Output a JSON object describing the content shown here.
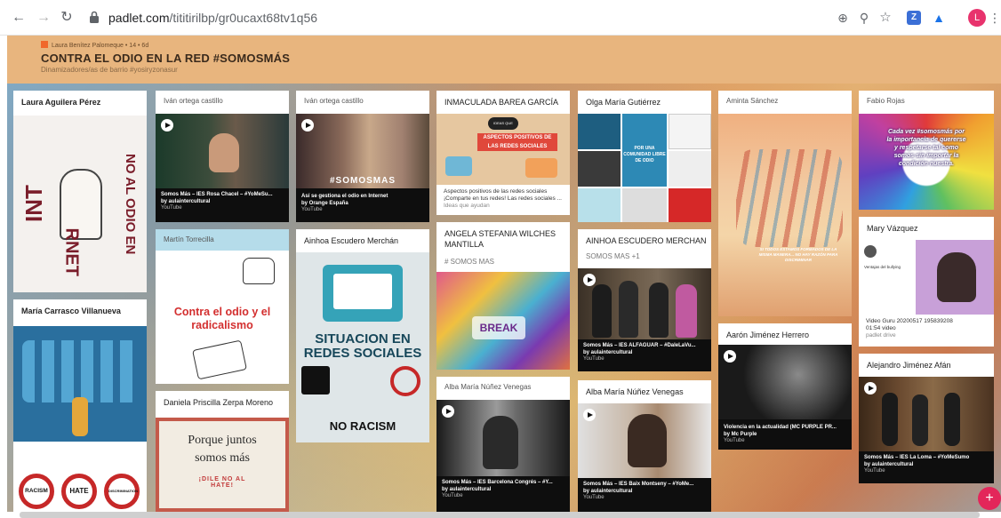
{
  "browser": {
    "url_host": "padlet.com",
    "url_path": "/tititirilbp/gr0ucaxt68tv1q56",
    "avatar_letter": "L",
    "ext_letter": "Z"
  },
  "header": {
    "author": "Laura Benítez Palomeque",
    "meta": "• 14 • 6d",
    "title": "CONTRA EL ODIO EN LA RED #SOMOSMÁS",
    "subtitle": "Dinamizadores/as de barrio #yosiryzonasur"
  },
  "cards": {
    "c1": {
      "title": "Laura Aguilera Pérez",
      "img_left": "INT",
      "img_right": "NO AL ODIO EN",
      "img_bottom": "RNET"
    },
    "c2": {
      "author": "Iván ortega castillo",
      "video_title": "Somos Más – IES Rosa Chacel – #YoMeSu...",
      "video_by": "by aulaintercultural",
      "video_src": "YouTube"
    },
    "c3": {
      "author": "Iván ortega castillo",
      "video_title": "Así se gestiona el odio en Internet",
      "video_by": "by Orange España",
      "video_src": "YouTube",
      "overlay": "#SOMOSMAS"
    },
    "c4": {
      "title": "INMACULADA BAREA GARCÍA",
      "img_text": "ASPECTOS POSITIVOS DE LAS REDES SOCIALES",
      "img_badge": "IDEAS QUE AYUDAN",
      "link_title": "Aspectos positivos de las redes sociales ¡Comparte en tus redes! Las redes sociales ...",
      "link_src": "Ideas que ayudan"
    },
    "c5": {
      "title": "Olga María Gutiérrez",
      "img_text": "POR UNA COMUNIDAD LIBRE DE ODIO"
    },
    "c6": {
      "author": "Aminta Sánchez",
      "img_text": "SI TODOS ESTAMOS FORMADOS DE LA MISMA MANERA... NO HAY RAZÓN PARA DISCRIMINAR"
    },
    "c7": {
      "author": "Fabio Rojas",
      "img_text": "Cada vez #somosmás por la importancia de quererse y respetarse tal como somos sin importar la condición nuestra."
    },
    "c8": {
      "author": "Martín Torrecilla",
      "img_text": "Contra el odio y el radicalismo"
    },
    "c9": {
      "title": "Ainhoa Escudero Merchán",
      "img_text": "SITUACION EN REDES SOCIALES",
      "img_bottom": "NO RACISM"
    },
    "c10": {
      "title": "ANGELA STEFANIA WILCHES MANTILLA",
      "tag": "# SOMOS MAS",
      "img_text": "BREAK"
    },
    "c11": {
      "title": "AINHOA ESCUDERO MERCHAN",
      "tag": "SOMOS MAS +1",
      "video_title": "Somos Más – IES ALFAGUAR – #DaleLaVu...",
      "video_by": "by aulaintercultural",
      "video_src": "YouTube"
    },
    "c12": {
      "title": "Mary Vázquez",
      "video_title": "Video Guru 20200517 195839208",
      "video_by": "01:54 video",
      "video_src": "padlet drive",
      "overlay": "Ventajas del bullying"
    },
    "c13": {
      "title": "María Carrasco Villanueva",
      "badges": [
        "RACISM",
        "HATE",
        "DISCRIMINATION"
      ]
    },
    "c14": {
      "title": "Daniela Priscilla Zerpa Moreno",
      "img_line1": "Porque juntos",
      "img_line2": "somos más",
      "img_line3": "¡DILE NO AL HATE!"
    },
    "c15": {
      "author": "Alba María Núñez Venegas",
      "video_title": "Somos Más – IES Barcelona Congrés – #Y...",
      "video_by": "by aulaintercultural",
      "video_src": "YouTube"
    },
    "c16": {
      "title": "Alba María Núñez Venegas",
      "video_title": "Somos Más – IES Baix Montseny – #YoMe...",
      "video_by": "by aulaintercultural",
      "video_src": "YouTube"
    },
    "c17": {
      "title": "Aarón Jiménez Herrero",
      "video_title": "Violencia en la actualidad (MC PURPLE PR...",
      "video_by": "by Mc Purple",
      "video_src": "YouTube"
    },
    "c18": {
      "title": "Alejandro Jiménez Afán",
      "video_title": "Somos Más – IES La Loma – #YoMeSumo",
      "video_by": "by aulaintercultural",
      "video_src": "YouTube"
    }
  },
  "fab_label": "+"
}
